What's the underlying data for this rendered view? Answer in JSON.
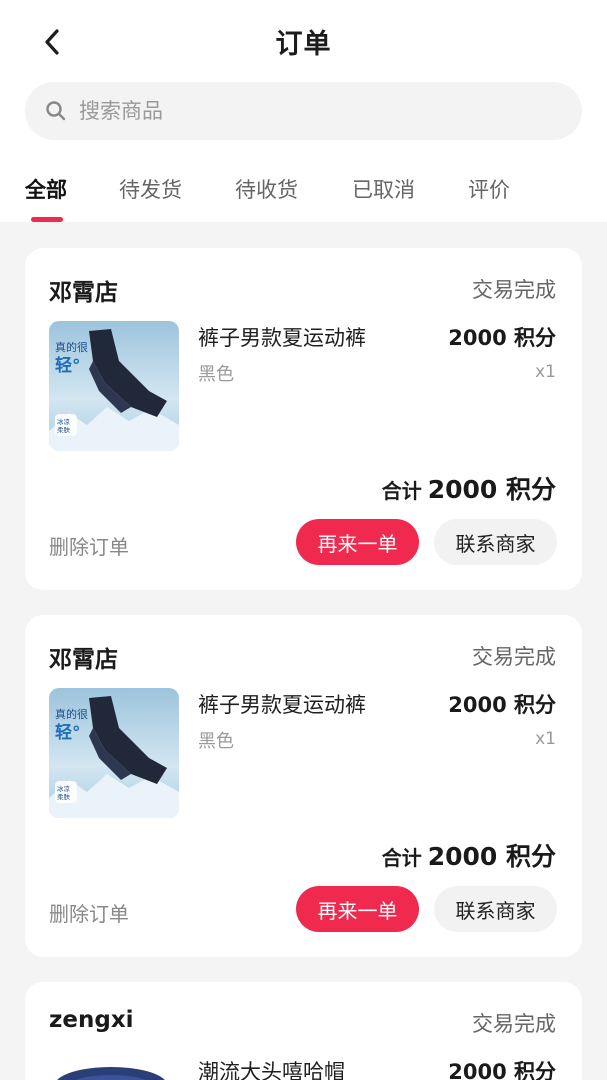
{
  "header": {
    "title": "订单",
    "back_icon": "chevron-left-icon"
  },
  "search": {
    "placeholder": "搜索商品",
    "icon": "search-icon"
  },
  "tabs": [
    {
      "label": "全部",
      "active": true
    },
    {
      "label": "待发货",
      "active": false
    },
    {
      "label": "待收货",
      "active": false
    },
    {
      "label": "已取消",
      "active": false
    },
    {
      "label": "评价",
      "active": false
    }
  ],
  "accent_color": "#f0294e",
  "orders": [
    {
      "shop": "邓霄店",
      "status": "交易完成",
      "product": {
        "name": "裤子男款夏运动裤",
        "price": "2000 积分",
        "variant": "黑色",
        "quantity": "x1",
        "image_text": {
          "l1": "真的很",
          "l2": "轻°",
          "tag": "冰凉\n柔肤"
        }
      },
      "total_label": "合计",
      "total_value": "2000 积分",
      "delete_label": "删除订单",
      "reorder_label": "再来一单",
      "contact_label": "联系商家"
    },
    {
      "shop": "邓霄店",
      "status": "交易完成",
      "product": {
        "name": "裤子男款夏运动裤",
        "price": "2000 积分",
        "variant": "黑色",
        "quantity": "x1",
        "image_text": {
          "l1": "真的很",
          "l2": "轻°",
          "tag": "冰凉\n柔肤"
        }
      },
      "total_label": "合计",
      "total_value": "2000 积分",
      "delete_label": "删除订单",
      "reorder_label": "再来一单",
      "contact_label": "联系商家"
    },
    {
      "shop": "zengxi",
      "status": "交易完成",
      "product": {
        "name": "潮流大头嘻哈帽",
        "price": "2000 积分"
      }
    }
  ]
}
